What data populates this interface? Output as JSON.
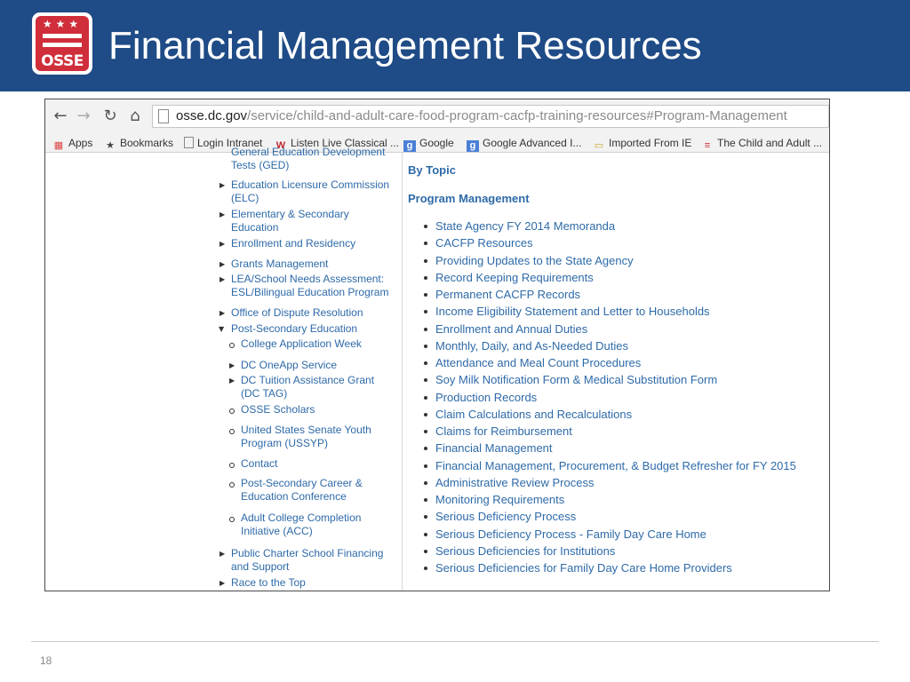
{
  "slide": {
    "title": "Financial Management Resources",
    "page_number": "18",
    "logo": {
      "text": "OSSE",
      "stars": "★★★"
    }
  },
  "browser": {
    "url_domain": "osse.dc.gov",
    "url_path": "/service/child-and-adult-care-food-program-cacfp-training-resources#Program-Management",
    "bookmarks": [
      {
        "label": "Apps",
        "icon": "apps-grid-icon"
      },
      {
        "label": "Bookmarks",
        "icon": "star-icon"
      },
      {
        "label": "Login Intranet",
        "icon": "page-icon"
      },
      {
        "label": "Listen Live Classical ...",
        "icon": "w-logo-icon"
      },
      {
        "label": "Google",
        "icon": "google-icon"
      },
      {
        "label": "Google Advanced I...",
        "icon": "google-icon"
      },
      {
        "label": "Imported From IE",
        "icon": "folder-icon"
      },
      {
        "label": "The Child and Adult ...",
        "icon": "dc-flag-icon"
      }
    ]
  },
  "left_nav": {
    "items": [
      {
        "line1": "General Education Development",
        "line2": "Tests (GED)"
      },
      {
        "line1": "Education Licensure Commission",
        "line2": "(ELC)"
      },
      {
        "line1": "Elementary & Secondary",
        "line2": "Education"
      },
      {
        "line1": "Enrollment and Residency",
        "line2": ""
      },
      {
        "line1": "Grants Management",
        "line2": ""
      },
      {
        "line1": "LEA/School Needs Assessment:",
        "line2": "ESL/Bilingual Education Program"
      },
      {
        "line1": "Office of Dispute Resolution",
        "line2": ""
      },
      {
        "line1": "Post-Secondary Education",
        "line2": ""
      },
      {
        "line1": "Public Charter School Financing",
        "line2": "and Support"
      },
      {
        "line1": "Race to the Top",
        "line2": ""
      }
    ],
    "sub_items": [
      {
        "line1": "College Application Week",
        "line2": ""
      },
      {
        "line1": "DC OneApp Service",
        "line2": ""
      },
      {
        "line1": "DC Tuition Assistance Grant",
        "line2": "(DC TAG)"
      },
      {
        "line1": "OSSE Scholars",
        "line2": ""
      },
      {
        "line1": "United States Senate Youth",
        "line2": "Program (USSYP)"
      },
      {
        "line1": "Contact",
        "line2": ""
      },
      {
        "line1": "Post-Secondary Career &",
        "line2": "Education Conference"
      },
      {
        "line1": "Adult College Completion",
        "line2": "Initiative (ACC)"
      }
    ]
  },
  "main": {
    "by_topic": "By Topic",
    "section_heading": "Program Management",
    "links": [
      "State Agency FY 2014 Memoranda",
      "CACFP Resources",
      "Providing Updates to the State Agency",
      "Record Keeping Requirements",
      "Permanent CACFP Records",
      "Income Eligibility Statement and Letter to Households",
      "Enrollment and Annual Duties",
      "Monthly, Daily, and As-Needed Duties",
      "Attendance and Meal Count Procedures",
      "Soy Milk Notification Form & Medical Substitution Form",
      "Production Records",
      "Claim Calculations and Recalculations",
      "Claims for Reimbursement",
      "Financial Management",
      "Financial Management, Procurement, & Budget Refresher for FY 2015",
      "Administrative Review Process",
      "Monitoring Requirements",
      "Serious Deficiency Process",
      "Serious Deficiency Process - Family Day Care Home",
      "Serious Deficiencies for Institutions",
      "Serious Deficiencies for Family Day Care Home Providers"
    ]
  },
  "colors": {
    "header_bg": "#1f4b86",
    "link": "#2e6aa8",
    "logo_red": "#cf2e3a"
  }
}
